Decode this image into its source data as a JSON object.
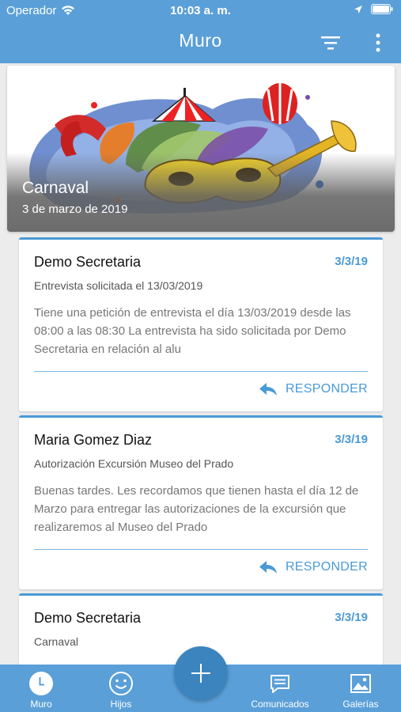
{
  "status_bar": {
    "carrier": "Operador",
    "time": "10:03 a. m."
  },
  "nav": {
    "title": "Muro",
    "icons": [
      "filter-icon",
      "more-vertical-icon"
    ]
  },
  "hero": {
    "title": "Carnaval",
    "date": "3 de marzo de 2019"
  },
  "posts": [
    {
      "author": "Demo Secretaria",
      "date": "3/3/19",
      "subject": "Entrevista solicitada el 13/03/2019",
      "body": "Tiene una petición de entrevista el día 13/03/2019 desde las 08:00 a las 08:30 La entrevista ha sido solicitada por Demo Secretaria en relación al alu",
      "reply_label": "RESPONDER"
    },
    {
      "author": "Maria Gomez Diaz",
      "date": "3/3/19",
      "subject": "Autorización Excursión Museo del Prado",
      "body": "Buenas tardes. Les recordamos que tienen hasta el día 12 de Marzo para entregar las autorizaciones de la excursión que realizaremos al Museo del Prado",
      "reply_label": "RESPONDER"
    },
    {
      "author": "Demo Secretaria",
      "date": "3/3/19",
      "subject": "Carnaval"
    }
  ],
  "tabs": [
    {
      "label": "Muro",
      "icon": "clock-icon",
      "active": true
    },
    {
      "label": "Hijos",
      "icon": "smiley-icon"
    },
    {
      "label": "Comunicados",
      "icon": "message-icon"
    },
    {
      "label": "Galerías",
      "icon": "gallery-icon"
    }
  ],
  "fab": {
    "icon": "plus-icon"
  },
  "colors": {
    "primary": "#5a9fd8",
    "accent": "#4a9ad6",
    "fab": "#3c84be",
    "background": "#ececec"
  }
}
